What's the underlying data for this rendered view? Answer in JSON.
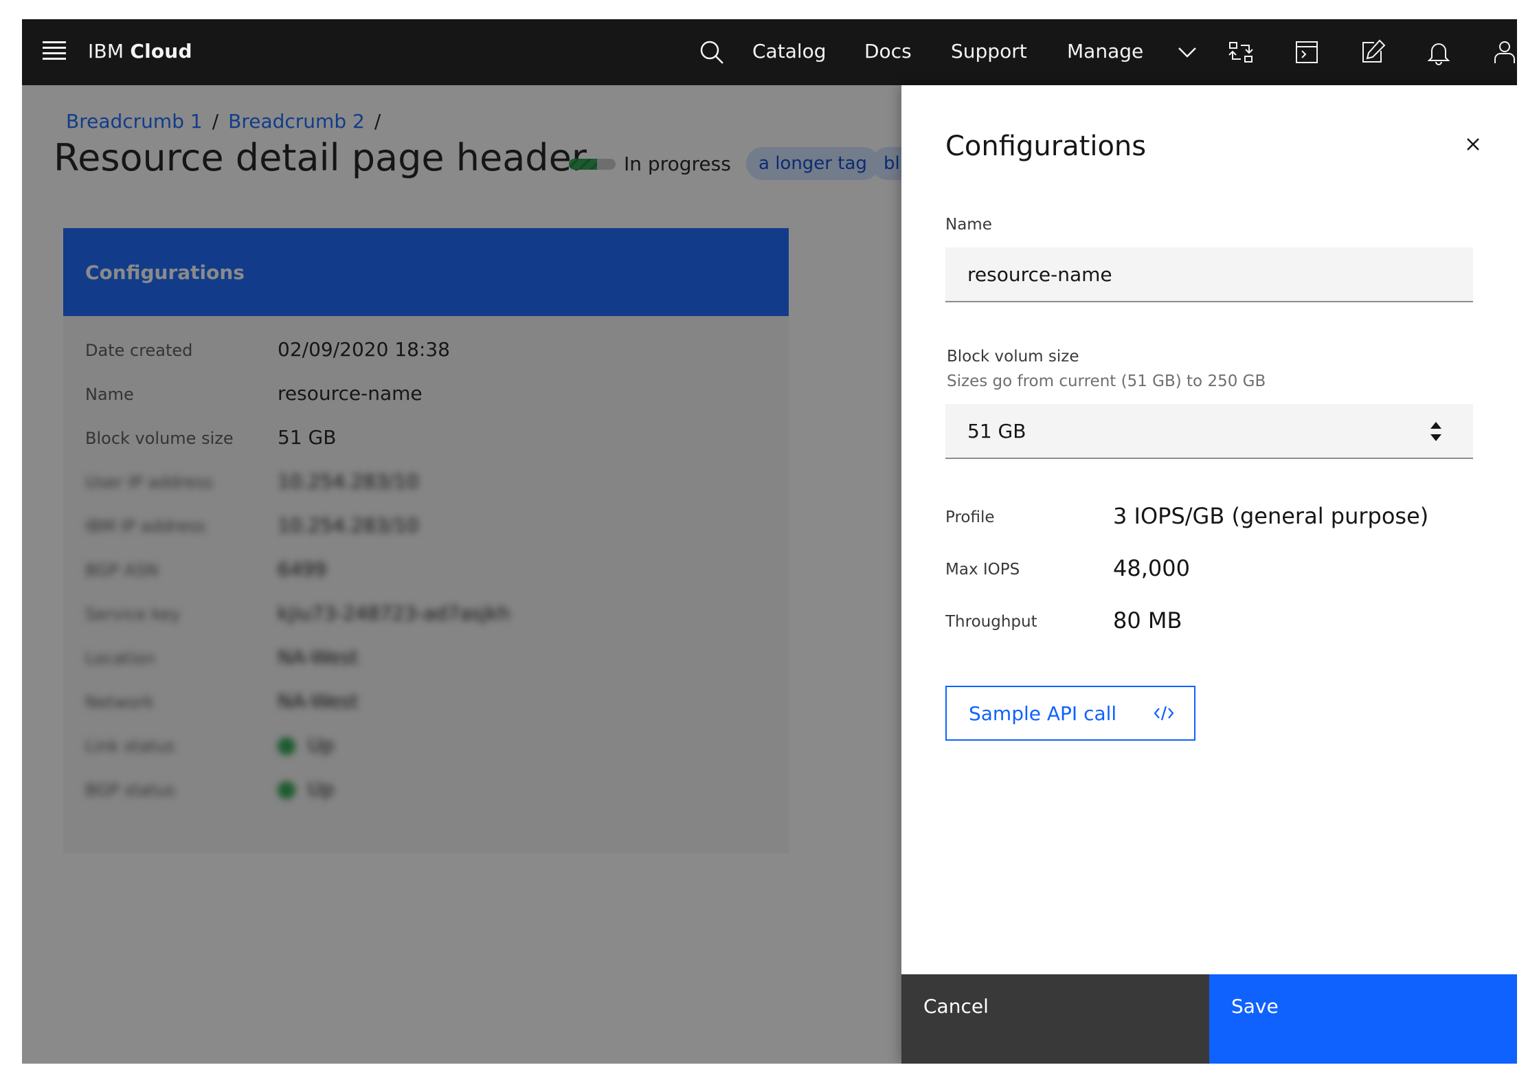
{
  "topbar": {
    "brand_regular": "IBM ",
    "brand_bold": "Cloud",
    "links": {
      "catalog": "Catalog",
      "docs": "Docs",
      "support": "Support",
      "manage": "Manage"
    },
    "icons": [
      "search-icon",
      "chevron-down-icon",
      "switcher-icon",
      "terminal-icon",
      "edit-icon",
      "notification-icon",
      "user-icon"
    ]
  },
  "page": {
    "breadcrumbs": [
      "Breadcrumb 1",
      "Breadcrumb 2"
    ],
    "separator": "/",
    "title": "Resource detail page header",
    "status_label": "In progress",
    "status_progress": 0.6,
    "tags": [
      "a longer tag",
      "blu"
    ],
    "card": {
      "title": "Configurations",
      "rows": [
        {
          "label": "Date created",
          "value": "02/09/2020 18:38"
        },
        {
          "label": "Name",
          "value": "resource-name"
        },
        {
          "label": "Block volume size",
          "value": "51 GB"
        },
        {
          "label": "User IP address",
          "value": "10.254.283/10"
        },
        {
          "label": "IBM IP address",
          "value": "10.254.283/10"
        },
        {
          "label": "BGP ASN",
          "value": "6499"
        },
        {
          "label": "Service key",
          "value": "kjiu73-248723-ad7asjkh"
        },
        {
          "label": "Location",
          "value": "NA-West"
        },
        {
          "label": "Network",
          "value": "NA-West"
        },
        {
          "label": "Link status",
          "value": "Up"
        },
        {
          "label": "BGP status",
          "value": "Up"
        }
      ]
    }
  },
  "panel": {
    "title": "Configurations",
    "name_label": "Name",
    "name_value": "resource-name",
    "size_label": "Block volum size",
    "size_helper": "Sizes go from current (51 GB) to 250 GB",
    "size_value": "51 GB",
    "details": [
      {
        "label": "Profile",
        "value": "3 IOPS/GB (general purpose)"
      },
      {
        "label": "Max IOPS",
        "value": "48,000"
      },
      {
        "label": "Throughput",
        "value": "80 MB"
      }
    ],
    "api_button": "Sample API call",
    "cancel": "Cancel",
    "save": "Save"
  },
  "colors": {
    "brand_blue": "#0f62fe",
    "shell": "#161616",
    "success": "#24a148",
    "tag_bg": "#d0e2ff"
  }
}
